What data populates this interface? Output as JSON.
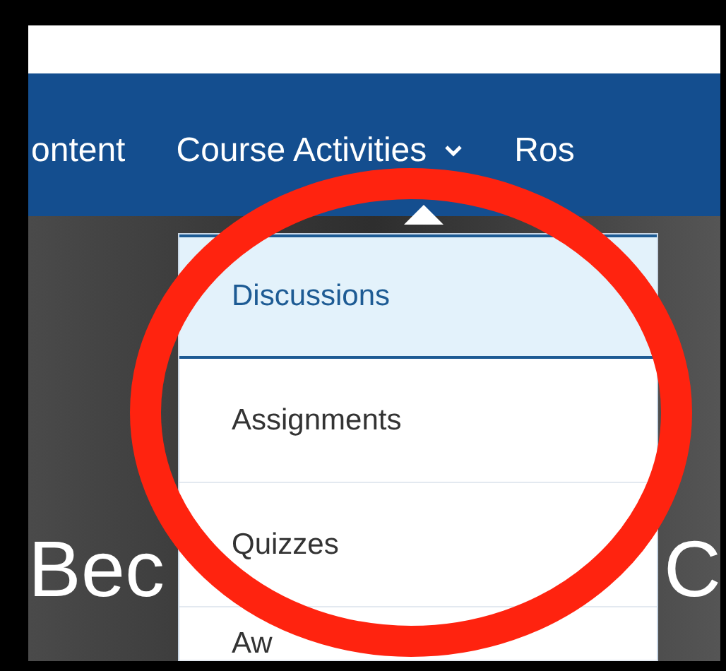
{
  "nav": {
    "items": [
      {
        "label": "ontent",
        "kind": "link"
      },
      {
        "label": "Course Activities",
        "kind": "menu"
      },
      {
        "label": "Ros",
        "kind": "link"
      }
    ]
  },
  "dropdown": {
    "items": [
      {
        "label": "Discussions",
        "selected": true
      },
      {
        "label": "Assignments",
        "selected": false
      },
      {
        "label": "Quizzes",
        "selected": false
      },
      {
        "label": "Aw",
        "selected": false
      }
    ]
  },
  "hero": {
    "title_left": "Bec",
    "title_right": "C"
  },
  "annotation": {
    "kind": "circle",
    "color": "#ff230f"
  }
}
